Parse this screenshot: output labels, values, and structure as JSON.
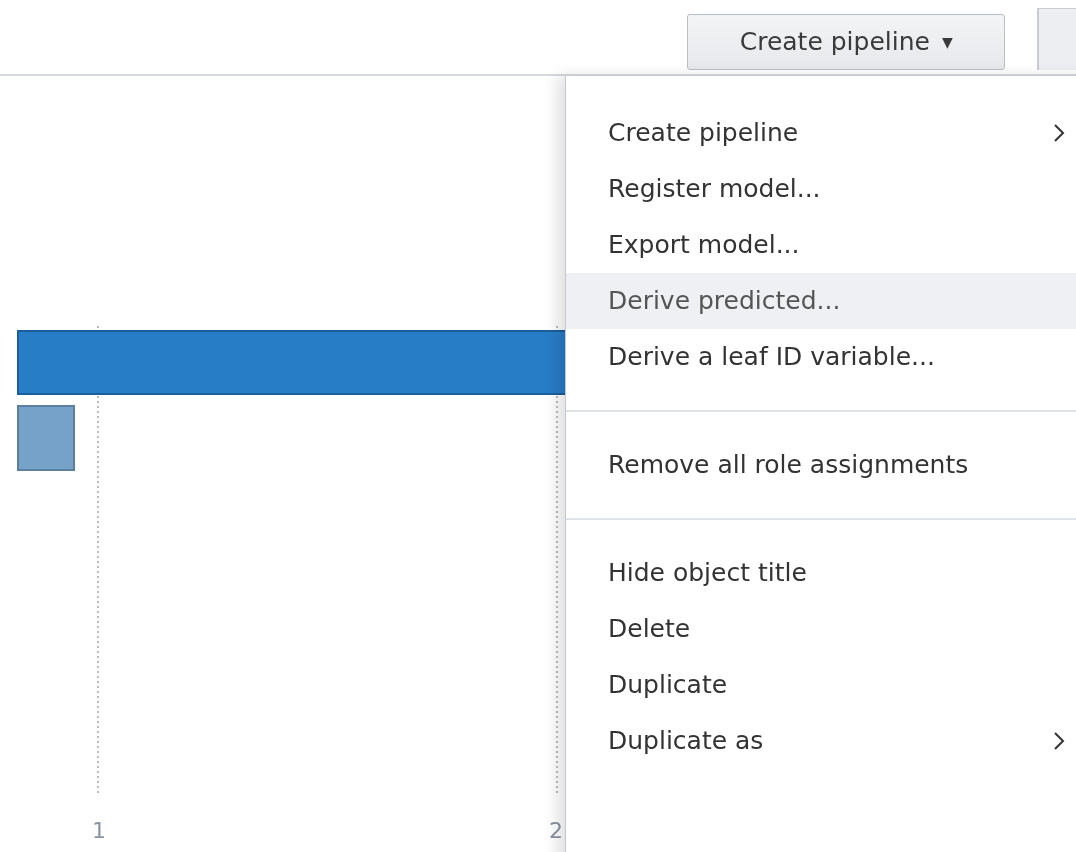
{
  "toolbar": {
    "button": {
      "label": "Create pipeline",
      "caret": "▼"
    }
  },
  "chart": {
    "tick_labels": [
      "1",
      "2"
    ]
  },
  "menu": {
    "items": [
      {
        "kind": "item",
        "label": "Create pipeline",
        "submenu": true,
        "highlighted": false
      },
      {
        "kind": "item",
        "label": "Register model...",
        "submenu": false,
        "highlighted": false
      },
      {
        "kind": "item",
        "label": "Export model...",
        "submenu": false,
        "highlighted": false
      },
      {
        "kind": "item",
        "label": "Derive predicted...",
        "submenu": false,
        "highlighted": true
      },
      {
        "kind": "item",
        "label": "Derive a leaf ID variable...",
        "submenu": false,
        "highlighted": false
      },
      {
        "kind": "separator"
      },
      {
        "kind": "item",
        "label": "Remove all role assignments",
        "submenu": false,
        "highlighted": false
      },
      {
        "kind": "separator"
      },
      {
        "kind": "item",
        "label": "Hide object title",
        "submenu": false,
        "highlighted": false
      },
      {
        "kind": "item",
        "label": "Delete",
        "submenu": false,
        "highlighted": false
      },
      {
        "kind": "item",
        "label": "Duplicate",
        "submenu": false,
        "highlighted": false
      },
      {
        "kind": "item",
        "label": "Duplicate as",
        "submenu": true,
        "highlighted": false
      }
    ]
  }
}
